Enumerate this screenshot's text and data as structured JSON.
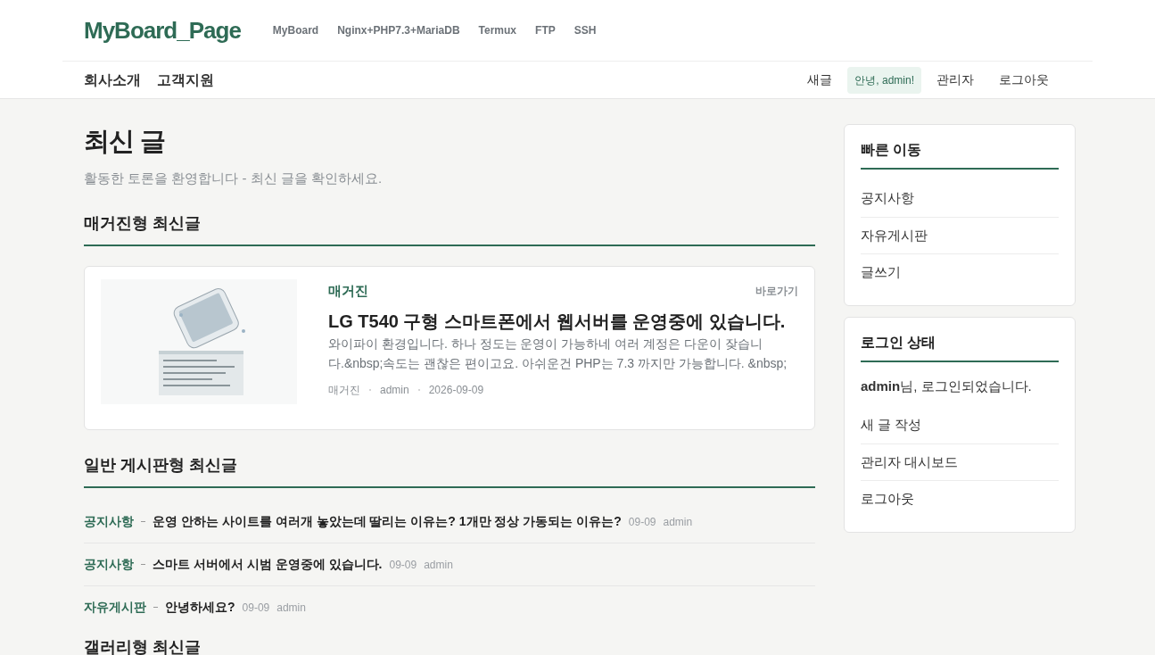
{
  "brand": "MyBoard_Page",
  "top_nav": [
    "MyBoard",
    "Nginx+PHP7.3+MariaDB",
    "Termux",
    "FTP",
    "SSH"
  ],
  "sub_nav": [
    "회사소개",
    "고객지원"
  ],
  "user_nav": [
    {
      "label": "새글",
      "kind": "link"
    },
    {
      "label": "안녕, admin!",
      "kind": "badge"
    },
    {
      "label": "관리자",
      "kind": "link"
    },
    {
      "label": "로그아웃",
      "kind": "link"
    }
  ],
  "page_title": "최신 글",
  "page_subtitle": "활동한 토론을 환영합니다 - 최신 글을 확인하세요.",
  "magazine": {
    "heading": "매거진형 최신글",
    "card": {
      "image": {
        "kind": "picture"
      },
      "category": "매거진",
      "more": "바로가기",
      "title": "LG T540 구형 스마트폰에서 웹서버를 운영중에 있습니다.",
      "excerpt": "와이파이 환경입니다. 하나 정도는 운영이 가능하네 여러 계정은 다운이 잦습니다.&nbsp;속도는 괜찮은 편이고요. 아쉬운건 PHP는 7.3 까지만 가능합니다. &nbsp;",
      "meta": [
        "매거진",
        "admin",
        "2026-09-09"
      ]
    }
  },
  "board": {
    "heading": "일반 게시판형 최신글",
    "rows": [
      {
        "board": "공지사항",
        "title": "운영 안하는 사이트를 여러개 놓았는데 딸리는 이유는? 1개만 정상 가동되는 이유는?",
        "date": "09-09",
        "author": "admin"
      },
      {
        "board": "공지사항",
        "title": "스마트 서버에서 시범 운영중에 있습니다.",
        "date": "09-09",
        "author": "admin"
      },
      {
        "board": "자유게시판",
        "title": "안녕하세요?",
        "date": "09-09",
        "author": "admin"
      }
    ]
  },
  "gallery": {
    "heading": "갤러리형 최신글"
  },
  "quick_links": {
    "title": "빠른 이동",
    "items": [
      "공지사항",
      "자유게시판",
      "글쓰기"
    ]
  },
  "login_status": {
    "title": "로그인 상태",
    "user": "admin",
    "message": "님, 로그인되었습니다.",
    "items": [
      "새 글 작성",
      "관리자 대시보드",
      "로그아웃"
    ]
  }
}
